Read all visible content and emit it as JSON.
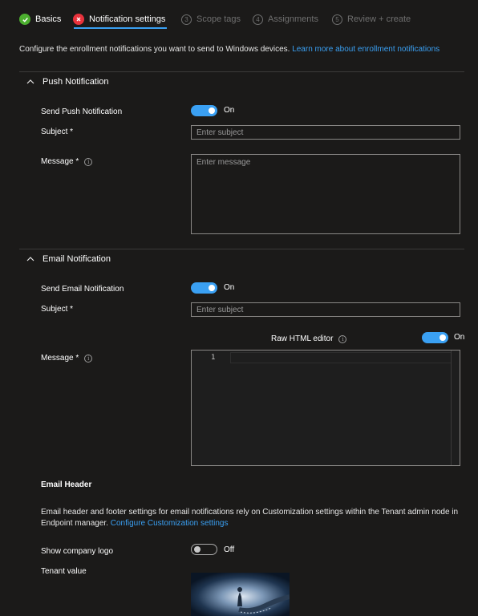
{
  "wizard": {
    "steps": [
      {
        "label": "Basics",
        "status": "done"
      },
      {
        "label": "Notification settings",
        "status": "error"
      },
      {
        "label": "Scope tags",
        "number": "3",
        "status": "pending"
      },
      {
        "label": "Assignments",
        "number": "4",
        "status": "pending"
      },
      {
        "label": "Review + create",
        "number": "5",
        "status": "pending"
      }
    ]
  },
  "intro": {
    "text": "Configure the enrollment notifications you want to send to Windows devices.",
    "link": "Learn more about enrollment notifications"
  },
  "push": {
    "title": "Push Notification",
    "send_label": "Send Push Notification",
    "send_state": "On",
    "subject_label": "Subject *",
    "subject_placeholder": "Enter subject",
    "message_label": "Message *",
    "message_placeholder": "Enter message"
  },
  "email": {
    "title": "Email Notification",
    "send_label": "Send Email Notification",
    "send_state": "On",
    "subject_label": "Subject *",
    "subject_placeholder": "Enter subject",
    "raw_html_label": "Raw HTML editor",
    "raw_html_state": "On",
    "message_label": "Message *",
    "editor_line_number": "1"
  },
  "email_header": {
    "title": "Email Header",
    "description": "Email header and footer settings for email notifications rely on Customization settings within the Tenant admin node in Endpoint manager.",
    "link": "Configure Customization settings",
    "show_logo_label": "Show company logo",
    "show_logo_state": "Off",
    "tenant_value_label": "Tenant value"
  },
  "colors": {
    "accent": "#3aa0f3",
    "success": "#4caf2f",
    "error": "#e8323c",
    "background": "#1b1a19"
  }
}
